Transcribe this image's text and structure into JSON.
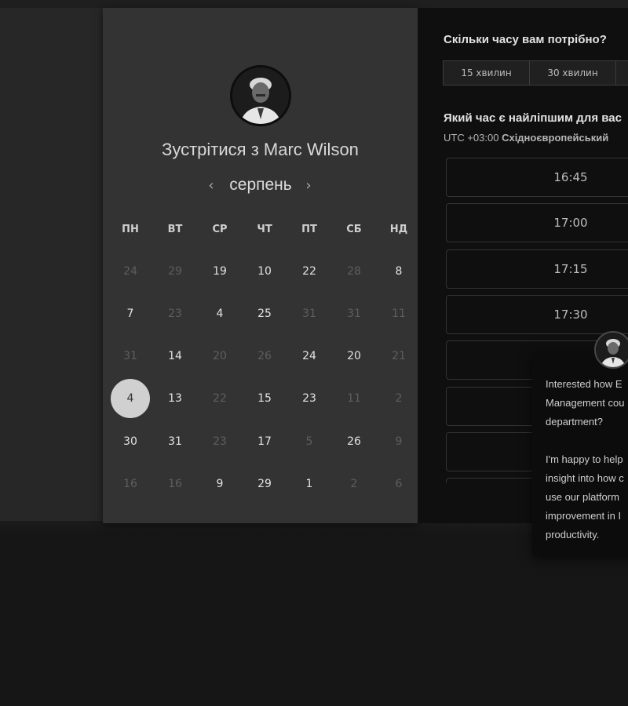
{
  "card": {
    "title_prefix": "Зустрітися з ",
    "host_name": "Marc Wilson",
    "month": "серпень",
    "prev_icon": "chevron-left-icon",
    "next_icon": "chevron-right-icon"
  },
  "weekdays": [
    "ПН",
    "ВТ",
    "СР",
    "ЧТ",
    "ПТ",
    "СБ",
    "НД"
  ],
  "calendar": {
    "weeks": [
      [
        {
          "d": "24",
          "a": false
        },
        {
          "d": "29",
          "a": false
        },
        {
          "d": "19",
          "a": true
        },
        {
          "d": "10",
          "a": true
        },
        {
          "d": "22",
          "a": true
        },
        {
          "d": "28",
          "a": false
        },
        {
          "d": "8",
          "a": true
        }
      ],
      [
        {
          "d": "7",
          "a": true
        },
        {
          "d": "23",
          "a": false
        },
        {
          "d": "4",
          "a": true
        },
        {
          "d": "25",
          "a": true
        },
        {
          "d": "31",
          "a": false
        },
        {
          "d": "31",
          "a": false
        },
        {
          "d": "11",
          "a": false
        }
      ],
      [
        {
          "d": "31",
          "a": false
        },
        {
          "d": "14",
          "a": true
        },
        {
          "d": "20",
          "a": false
        },
        {
          "d": "26",
          "a": false
        },
        {
          "d": "24",
          "a": true
        },
        {
          "d": "20",
          "a": true
        },
        {
          "d": "21",
          "a": false
        }
      ],
      [
        {
          "d": "4",
          "a": true,
          "selected": true
        },
        {
          "d": "13",
          "a": true
        },
        {
          "d": "22",
          "a": false
        },
        {
          "d": "15",
          "a": true
        },
        {
          "d": "23",
          "a": true
        },
        {
          "d": "11",
          "a": false
        },
        {
          "d": "2",
          "a": false
        }
      ],
      [
        {
          "d": "30",
          "a": true
        },
        {
          "d": "31",
          "a": true
        },
        {
          "d": "23",
          "a": false
        },
        {
          "d": "17",
          "a": true
        },
        {
          "d": "5",
          "a": false
        },
        {
          "d": "26",
          "a": true
        },
        {
          "d": "9",
          "a": false
        }
      ],
      [
        {
          "d": "16",
          "a": false
        },
        {
          "d": "16",
          "a": false
        },
        {
          "d": "9",
          "a": true
        },
        {
          "d": "29",
          "a": true
        },
        {
          "d": "1",
          "a": true
        },
        {
          "d": "2",
          "a": false
        },
        {
          "d": "6",
          "a": false
        }
      ]
    ]
  },
  "duration": {
    "heading": "Скільки часу вам потрібно?",
    "options": [
      "15 хвилин",
      "30 хвилин",
      ""
    ]
  },
  "time": {
    "heading": "Який час є найліпшим для вас",
    "tz_offset": "UTC +03:00",
    "tz_name": "Східноєвропейський",
    "slots": [
      "16:45",
      "17:00",
      "17:15",
      "17:30",
      "",
      "",
      "",
      ""
    ]
  },
  "chat": {
    "avatar_icon": "avatar-icon",
    "lines": [
      "Interested how E",
      "Management cou",
      "department?",
      "",
      "I'm happy to help",
      "insight into how c",
      "use our platform",
      "improvement in I",
      "productivity."
    ]
  },
  "colors": {
    "page_bg": "#161616",
    "card_bg": "#333333",
    "panel_bg": "#0f0f0f",
    "selected_day": "#d0d0d0"
  }
}
